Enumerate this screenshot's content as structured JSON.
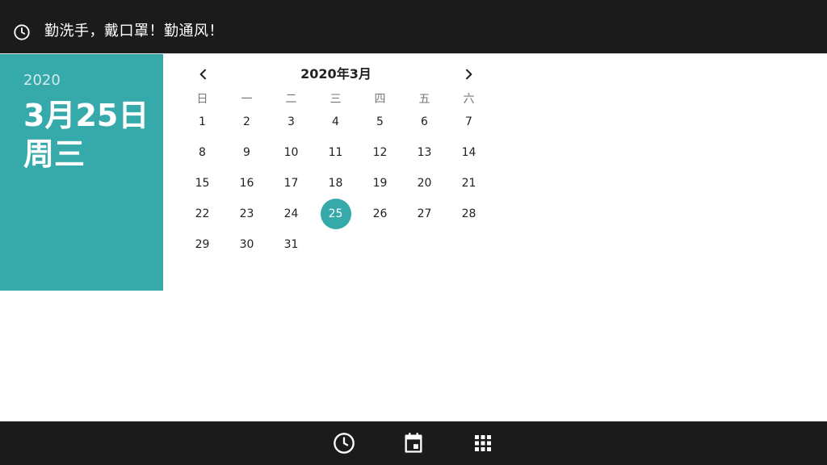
{
  "header": {
    "title": "勤洗手，戴口罩！勤通风！",
    "clock_icon": "clock-icon"
  },
  "date_panel": {
    "year": "2020",
    "date": "3月25日周三"
  },
  "calendar": {
    "month_title": "2020年3月",
    "weekdays": [
      "日",
      "一",
      "二",
      "三",
      "四",
      "五",
      "六"
    ],
    "days": [
      "1",
      "2",
      "3",
      "4",
      "5",
      "6",
      "7",
      "8",
      "9",
      "10",
      "11",
      "12",
      "13",
      "14",
      "15",
      "16",
      "17",
      "18",
      "19",
      "20",
      "21",
      "22",
      "23",
      "24",
      "25",
      "26",
      "27",
      "28",
      "29",
      "30",
      "31"
    ],
    "first_weekday_index": 0,
    "selected_day": "25"
  },
  "bottom_nav": {
    "items": [
      {
        "icon": "alarm-clock-icon"
      },
      {
        "icon": "calendar-icon"
      },
      {
        "icon": "apps-grid-icon"
      }
    ]
  },
  "colors": {
    "accent": "#36a9ab",
    "bar": "#1b1b1b"
  }
}
